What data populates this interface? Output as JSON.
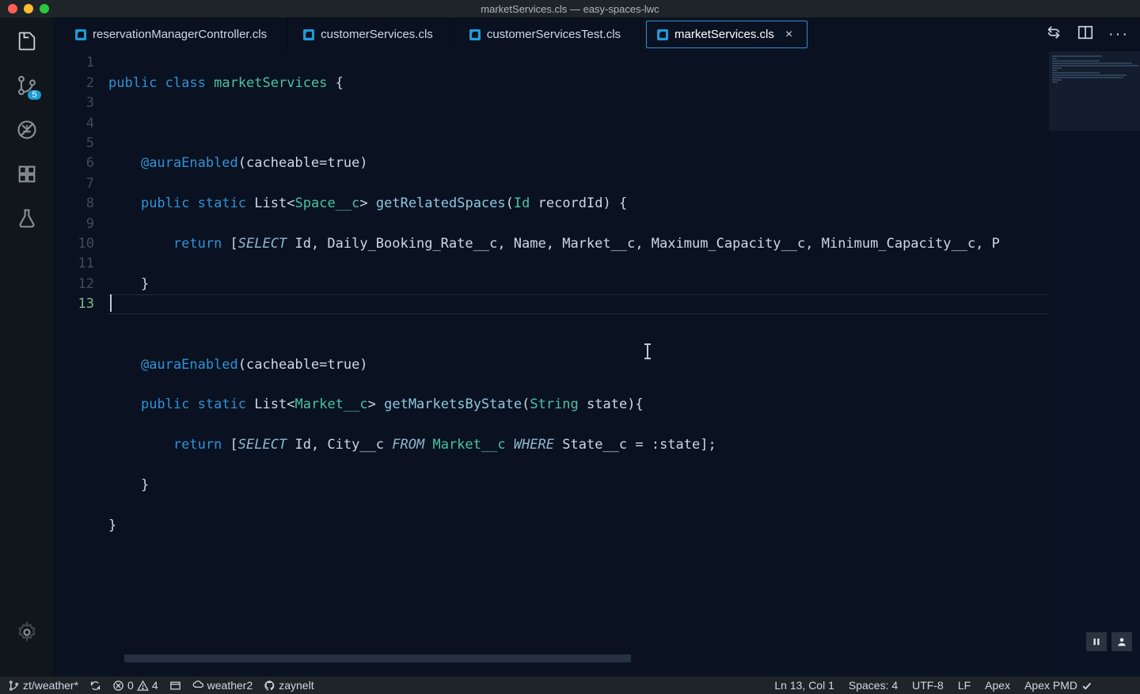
{
  "window": {
    "title": "marketServices.cls — easy-spaces-lwc"
  },
  "activity_bar": {
    "scm_badge": "5"
  },
  "tabs": [
    {
      "label": "reservationManagerController.cls",
      "active": false
    },
    {
      "label": "customerServices.cls",
      "active": false
    },
    {
      "label": "customerServicesTest.cls",
      "active": false
    },
    {
      "label": "marketServices.cls",
      "active": true
    }
  ],
  "gutter": [
    "1",
    "2",
    "3",
    "4",
    "5",
    "6",
    "7",
    "8",
    "9",
    "10",
    "11",
    "12",
    "13"
  ],
  "code": {
    "l1": {
      "kw1": "public",
      "kw2": "class",
      "name": "marketServices",
      "open": " {"
    },
    "l2": "",
    "l3": {
      "ann": "@auraEnabled",
      "rest": "(cacheable=true)"
    },
    "l4": {
      "kw1": "public",
      "kw2": "static",
      "list": "List",
      "lt": "<",
      "type": "Space__c",
      "gt": ">",
      "fn": " getRelatedSpaces",
      "open": "(",
      "id": "Id",
      "param": " recordId) {"
    },
    "l5": {
      "ret": "return",
      "open": " [",
      "sel": "SELECT",
      "cols": " Id, Daily_Booking_Rate__c, Name, Market__c, Maximum_Capacity__c, Minimum_Capacity__c, P"
    },
    "l6": "    }",
    "l7": "",
    "l8": {
      "ann": "@auraEnabled",
      "rest": "(cacheable=true)"
    },
    "l9": {
      "kw1": "public",
      "kw2": "static",
      "list": "List",
      "lt": "<",
      "type": "Market__c",
      "gt": ">",
      "fn": " getMarketsByState",
      "open": "(",
      "id": "String",
      "param": " state){"
    },
    "l10": {
      "ret": "return",
      "open": " [",
      "sel": "SELECT",
      "cols": " Id, City__c ",
      "from": "FROM",
      "tbl": " Market__c ",
      "where": "WHERE",
      "rest": " State__c = :state];"
    },
    "l11": "    }",
    "l12": "}",
    "l13": ""
  },
  "status": {
    "branch": "zt/weather*",
    "errors": "0",
    "warnings": "4",
    "org": "weather2",
    "gh_user": "zaynelt",
    "position": "Ln 13, Col 1",
    "indent": "Spaces: 4",
    "encoding": "UTF-8",
    "eol": "LF",
    "language": "Apex",
    "linter": "Apex PMD"
  }
}
